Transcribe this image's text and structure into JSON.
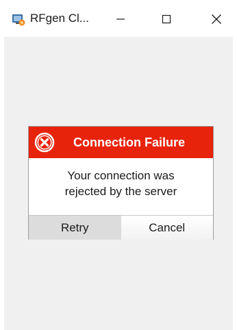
{
  "window": {
    "title": "RFgen Cl...",
    "app_icon": "rfgen-app-icon",
    "controls": {
      "minimize_icon": "minimize-icon",
      "maximize_icon": "maximize-icon",
      "close_icon": "close-icon"
    }
  },
  "dialog": {
    "title": "Connection Failure",
    "icon": "error-icon",
    "message_line1": "Your connection was",
    "message_line2": "rejected by the server",
    "buttons": {
      "retry": "Retry",
      "cancel": "Cancel"
    },
    "colors": {
      "header": "#e8230b",
      "client_background": "#f0f0f0"
    }
  }
}
